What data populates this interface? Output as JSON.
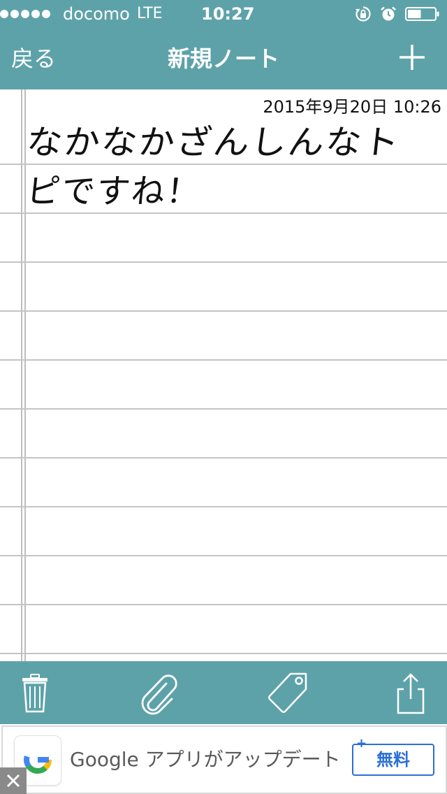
{
  "status_bar": {
    "carrier": "docomo",
    "network": "LTE",
    "time": "10:27",
    "signal_bars": 5,
    "battery_level": 0.5,
    "icons": [
      "lock-rotation-icon",
      "alarm-icon",
      "battery-icon"
    ]
  },
  "nav": {
    "back_label": "戻る",
    "title": "新規ノート",
    "add_icon": "plus-icon"
  },
  "note": {
    "date": "2015年9月20日 10:26",
    "lines": [
      "なかなかざんしんなト",
      "ピですね！"
    ]
  },
  "toolbar": {
    "items": [
      "trash-icon",
      "paperclip-icon",
      "tag-icon",
      "share-icon"
    ]
  },
  "ad": {
    "text": "Google アプリがアップデート",
    "cta": "無料",
    "cta_plus": "+",
    "logo": "google-logo-icon",
    "close_icon": "close-icon"
  },
  "colors": {
    "bar": "#5ea2a9",
    "rule": "#c4c4c4",
    "cta": "#2a6fd6"
  }
}
